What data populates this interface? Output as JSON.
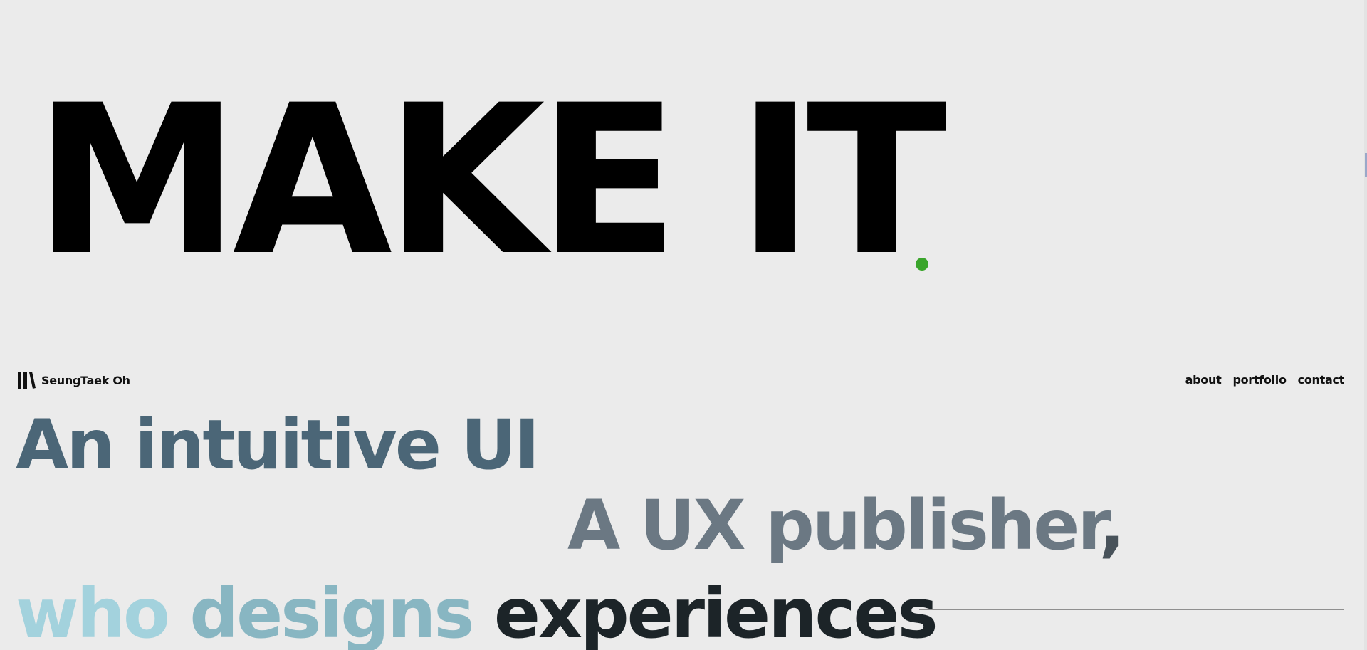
{
  "hero": {
    "title": "MAKE IT",
    "dot_color": "#3aa52b"
  },
  "header": {
    "logo_icon": "books-icon",
    "brand_name": "SeungTaek Oh",
    "nav": [
      "about",
      "portfolio",
      "contact"
    ]
  },
  "tagline": {
    "line1": "An intuitive UI",
    "line2_main": "A UX publisher",
    "line2_tail": ",",
    "line3": {
      "who": "who ",
      "designs": "designs ",
      "experiences": "experiences"
    }
  },
  "colors": {
    "background": "#ebebeb",
    "line1": "#4b6677",
    "line2": "#6b7883",
    "line3_who": "#a3d2dd",
    "line3_designs": "#88b6c2",
    "line3_experiences": "#1c2428",
    "accent_green": "#3aa52b"
  }
}
